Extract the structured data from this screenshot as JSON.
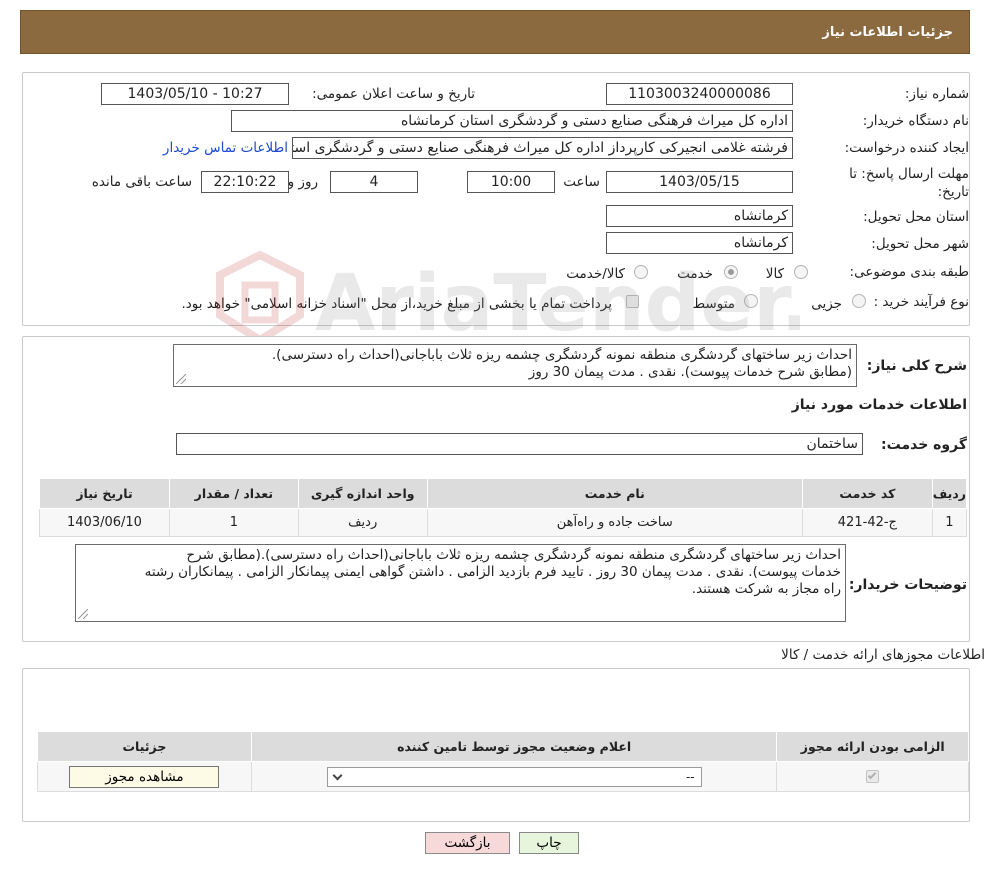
{
  "header": {
    "title": "جزئیات اطلاعات نیاز"
  },
  "form": {
    "need_number_label": "شماره نیاز:",
    "need_number": "1103003240000086",
    "announce_label": "تاریخ و ساعت اعلان عمومی:",
    "announce_value": "1403/05/10 - 10:27",
    "buyer_org_label": "نام دستگاه خریدار:",
    "buyer_org": "اداره کل میراث فرهنگی  صنایع دستی و گردشگری استان کرمانشاه",
    "creator_label": "ایجاد کننده درخواست:",
    "creator": "فرشته غلامی انجیرکی کارپرداز اداره کل میراث فرهنگی  صنایع دستی و گردشگری استان کرمانشاه",
    "contact_link": "اطلاعات تماس خریدار",
    "deadline_label_1": "مهلت ارسال پاسخ: تا",
    "deadline_label_2": "تاریخ:",
    "deadline_date": "1403/05/15",
    "time_label": "ساعت",
    "deadline_time": "10:00",
    "days_value": "4",
    "days_label": "روز و",
    "remaining_time": "22:10:22",
    "remaining_label": "ساعت باقی مانده",
    "province_label": "استان محل تحویل:",
    "province": "کرمانشاه",
    "city_label": "شهر محل تحویل:",
    "city": "کرمانشاه",
    "category_label": "طبقه بندی موضوعی:",
    "category_options": [
      "کالا",
      "خدمت",
      "کالا/خدمت"
    ],
    "purchase_type_label": "نوع فرآیند خرید :",
    "purchase_options": [
      "جزیی",
      "متوسط"
    ],
    "payment_note": "پرداخت تمام یا بخشی از مبلغ خرید،از محل \"اسناد خزانه اسلامی\" خواهد بود."
  },
  "summary": {
    "label": "شرح کلی نیاز:",
    "text_line1": "احداث زیر ساختهای گردشگری منطقه نمونه گردشگری چشمه ریزه ثلاث باباجانی(احداث راه دسترسی).",
    "text_line2": "(مطابق شرح خدمات پیوست). نقدی . مدت پیمان 30 روز"
  },
  "services": {
    "section_title": "اطلاعات خدمات مورد نیاز",
    "group_label": "گروه خدمت:",
    "group_value": "ساختمان",
    "columns": [
      "ردیف",
      "کد خدمت",
      "نام خدمت",
      "واحد اندازه گیری",
      "تعداد / مقدار",
      "تاریخ نیاز"
    ],
    "rows": [
      {
        "row": "1",
        "code": "ج-42-421",
        "name": "ساخت جاده و راه‌آهن",
        "unit": "ردیف",
        "qty": "1",
        "date": "1403/06/10"
      }
    ]
  },
  "buyer_notes": {
    "label": "توضیحات خریدار:",
    "line1": "احداث زیر ساختهای گردشگری منطقه نمونه گردشگری چشمه ریزه ثلاث باباجانی(احداث راه دسترسی).(مطابق شرح",
    "line2": "خدمات پیوست). نقدی . مدت پیمان 30 روز . تایید فرم بازدید الزامی . داشتن گواهی ایمنی پیمانکار الزامی . پیمانکاران رشته",
    "line3": "راه مجاز به شرکت هستند."
  },
  "permits": {
    "section_title": "اطلاعات مجوزهای ارائه خدمت / کالا",
    "columns": [
      "الزامی بودن ارائه مجوز",
      "اعلام وضعیت مجوز توسط تامین کننده",
      "جزئیات"
    ],
    "select_value": "--",
    "view_button": "مشاهده مجوز"
  },
  "footer": {
    "print_button": "چاپ",
    "back_button": "بازگشت"
  },
  "watermark": {
    "text": "AriaTender.neT"
  },
  "colors": {
    "header_bg": "#8c6a3f",
    "link": "#1a4ad0",
    "back_btn_bg": "#f7d9d9",
    "print_btn_bg": "#e6f5dc"
  }
}
